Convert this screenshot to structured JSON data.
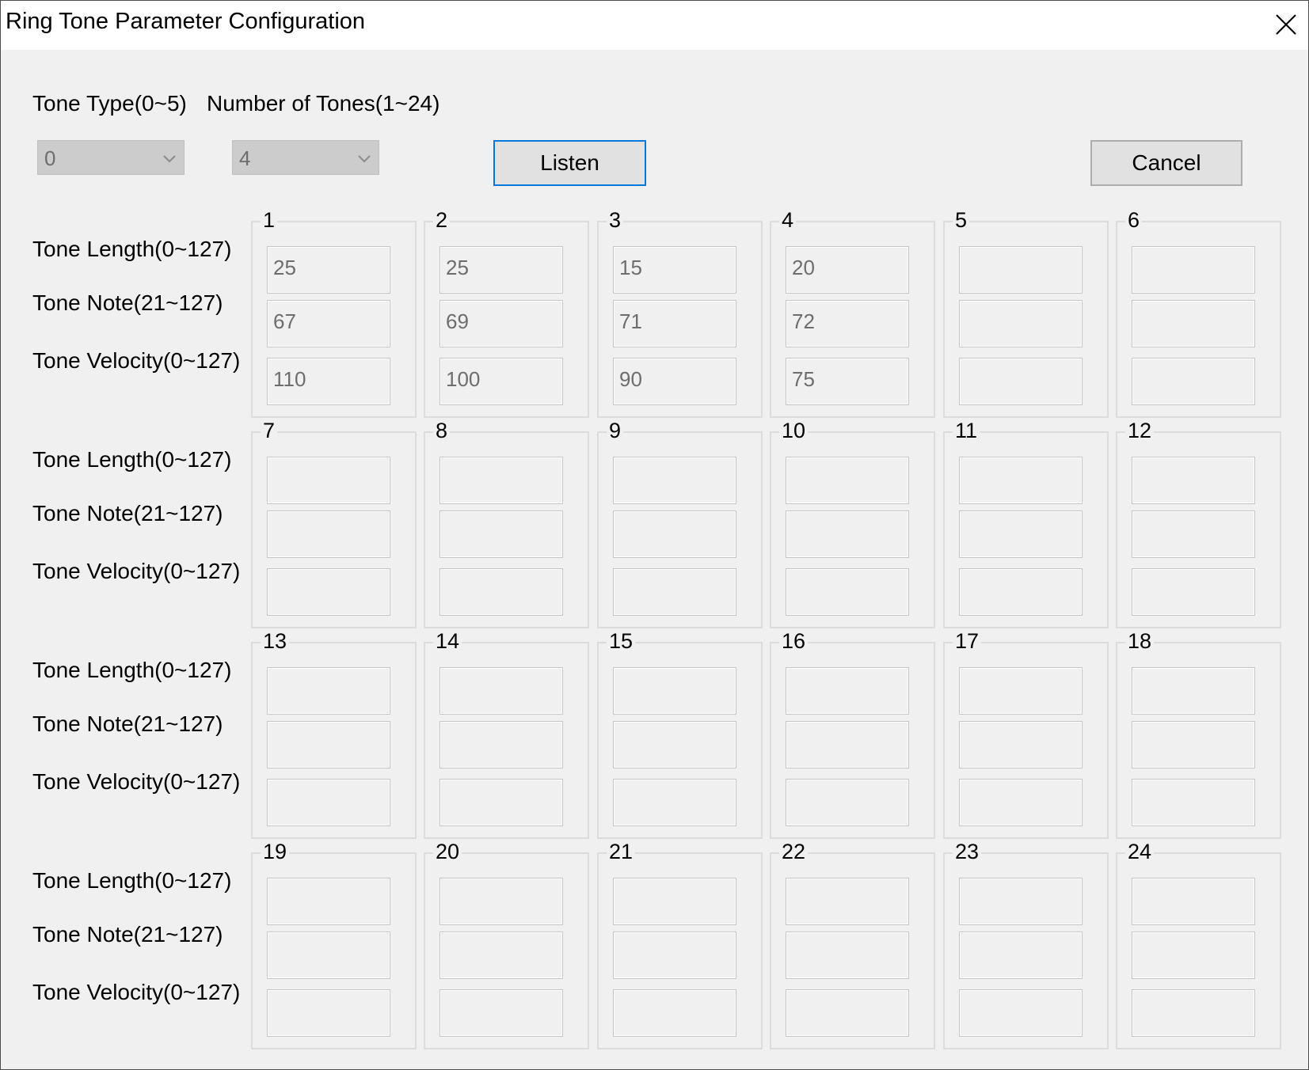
{
  "window": {
    "title": "Ring Tone Parameter Configuration"
  },
  "controls": {
    "tone_type_label": "Tone Type(0~5)",
    "number_of_tones_label": "Number of Tones(1~24)",
    "tone_type_value": "0",
    "number_of_tones_value": "4",
    "listen_label": "Listen",
    "cancel_label": "Cancel"
  },
  "row_labels": {
    "length": "Tone Length(0~127)",
    "note": "Tone Note(21~127)",
    "velocity": "Tone Velocity(0~127)"
  },
  "tones": [
    {
      "num": "1",
      "length": "25",
      "note": "67",
      "velocity": "110"
    },
    {
      "num": "2",
      "length": "25",
      "note": "69",
      "velocity": "100"
    },
    {
      "num": "3",
      "length": "15",
      "note": "71",
      "velocity": "90"
    },
    {
      "num": "4",
      "length": "20",
      "note": "72",
      "velocity": "75"
    },
    {
      "num": "5",
      "length": "",
      "note": "",
      "velocity": ""
    },
    {
      "num": "6",
      "length": "",
      "note": "",
      "velocity": ""
    },
    {
      "num": "7",
      "length": "",
      "note": "",
      "velocity": ""
    },
    {
      "num": "8",
      "length": "",
      "note": "",
      "velocity": ""
    },
    {
      "num": "9",
      "length": "",
      "note": "",
      "velocity": ""
    },
    {
      "num": "10",
      "length": "",
      "note": "",
      "velocity": ""
    },
    {
      "num": "11",
      "length": "",
      "note": "",
      "velocity": ""
    },
    {
      "num": "12",
      "length": "",
      "note": "",
      "velocity": ""
    },
    {
      "num": "13",
      "length": "",
      "note": "",
      "velocity": ""
    },
    {
      "num": "14",
      "length": "",
      "note": "",
      "velocity": ""
    },
    {
      "num": "15",
      "length": "",
      "note": "",
      "velocity": ""
    },
    {
      "num": "16",
      "length": "",
      "note": "",
      "velocity": ""
    },
    {
      "num": "17",
      "length": "",
      "note": "",
      "velocity": ""
    },
    {
      "num": "18",
      "length": "",
      "note": "",
      "velocity": ""
    },
    {
      "num": "19",
      "length": "",
      "note": "",
      "velocity": ""
    },
    {
      "num": "20",
      "length": "",
      "note": "",
      "velocity": ""
    },
    {
      "num": "21",
      "length": "",
      "note": "",
      "velocity": ""
    },
    {
      "num": "22",
      "length": "",
      "note": "",
      "velocity": ""
    },
    {
      "num": "23",
      "length": "",
      "note": "",
      "velocity": ""
    },
    {
      "num": "24",
      "length": "",
      "note": "",
      "velocity": ""
    }
  ],
  "icons": {
    "close": "close-icon",
    "dropdown": "chevron-down-icon"
  }
}
